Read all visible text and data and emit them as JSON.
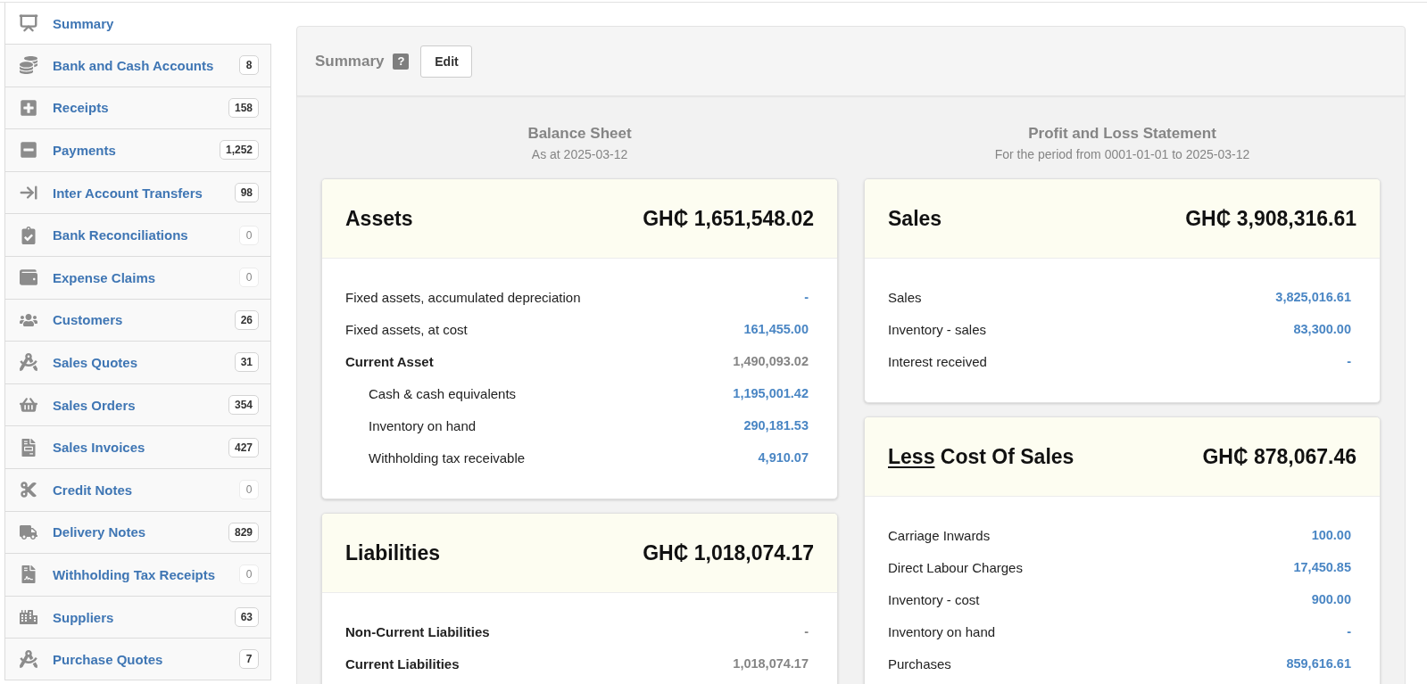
{
  "sidebar": {
    "items": [
      {
        "label": "Summary",
        "selected": true
      },
      {
        "label": "Bank and Cash Accounts",
        "selected": false,
        "badge": {
          "text": "8",
          "muted": false
        }
      },
      {
        "label": "Receipts",
        "selected": false,
        "badge": {
          "text": "158",
          "muted": false
        }
      },
      {
        "label": "Payments",
        "selected": false,
        "badge": {
          "text": "1,252",
          "muted": false
        }
      },
      {
        "label": "Inter Account Transfers",
        "selected": false,
        "badge": {
          "text": "98",
          "muted": false
        }
      },
      {
        "label": "Bank Reconciliations",
        "selected": false,
        "badge": {
          "text": "0",
          "muted": true
        }
      },
      {
        "label": "Expense Claims",
        "selected": false,
        "badge": {
          "text": "0",
          "muted": true
        }
      },
      {
        "label": "Customers",
        "selected": false,
        "badge": {
          "text": "26",
          "muted": false
        }
      },
      {
        "label": "Sales Quotes",
        "selected": false,
        "badge": {
          "text": "31",
          "muted": false
        }
      },
      {
        "label": "Sales Orders",
        "selected": false,
        "badge": {
          "text": "354",
          "muted": false
        }
      },
      {
        "label": "Sales Invoices",
        "selected": false,
        "badge": {
          "text": "427",
          "muted": false
        }
      },
      {
        "label": "Credit Notes",
        "selected": false,
        "badge": {
          "text": "0",
          "muted": true
        }
      },
      {
        "label": "Delivery Notes",
        "selected": false,
        "badge": {
          "text": "829",
          "muted": false
        }
      },
      {
        "label": "Withholding Tax Receipts",
        "selected": false,
        "badge": {
          "text": "0",
          "muted": true
        }
      },
      {
        "label": "Suppliers",
        "selected": false,
        "badge": {
          "text": "63",
          "muted": false
        }
      },
      {
        "label": "Purchase Quotes",
        "selected": false,
        "badge": {
          "text": "7",
          "muted": false
        }
      }
    ]
  },
  "header": {
    "title": "Summary",
    "help": "?",
    "edit_button": "Edit"
  },
  "columns": [
    {
      "title": "Balance Sheet",
      "subtitle": "As at 2025-03-12",
      "cards": [
        {
          "title": "Assets",
          "total": "GH₵ 1,651,548.02",
          "rows": [
            {
              "kind": "account",
              "label": "Fixed assets, accumulated depreciation",
              "value": "-"
            },
            {
              "kind": "account",
              "label": "Fixed assets, at cost",
              "value": "161,455.00"
            },
            {
              "kind": "group",
              "label": "Current Asset",
              "value": "1,490,093.02",
              "children": [
                {
                  "kind": "account",
                  "label": "Cash & cash equivalents",
                  "value": "1,195,001.42"
                },
                {
                  "kind": "account",
                  "label": "Inventory on hand",
                  "value": "290,181.53"
                },
                {
                  "kind": "account",
                  "label": "Withholding tax receivable",
                  "value": "4,910.07"
                }
              ]
            }
          ]
        },
        {
          "title": "Liabilities",
          "total": "GH₵ 1,018,074.17",
          "rows": [
            {
              "kind": "group",
              "label": "Non-Current Liabilities",
              "value": "-"
            },
            {
              "kind": "group",
              "label": "Current Liabilities",
              "value": "1,018,074.17"
            }
          ]
        }
      ]
    },
    {
      "title": "Profit and Loss Statement",
      "subtitle": "For the period from 0001-01-01 to 2025-03-12",
      "cards": [
        {
          "title": "Sales",
          "total": "GH₵ 3,908,316.61",
          "rows": [
            {
              "kind": "account",
              "label": "Sales",
              "value": "3,825,016.61"
            },
            {
              "kind": "account",
              "label": "Inventory - sales",
              "value": "83,300.00"
            },
            {
              "kind": "account",
              "label": "Interest received",
              "value": "-"
            }
          ]
        },
        {
          "title_prefix": "Less",
          "title": "Cost Of Sales",
          "total": "GH₵ 878,067.46",
          "rows": [
            {
              "kind": "account",
              "label": "Carriage Inwards",
              "value": "100.00"
            },
            {
              "kind": "account",
              "label": "Direct Labour Charges",
              "value": "17,450.85"
            },
            {
              "kind": "account",
              "label": "Inventory - cost",
              "value": "900.00"
            },
            {
              "kind": "account",
              "label": "Inventory on hand",
              "value": "-"
            },
            {
              "kind": "account",
              "label": "Purchases",
              "value": "859,616.61"
            }
          ]
        }
      ]
    }
  ]
}
